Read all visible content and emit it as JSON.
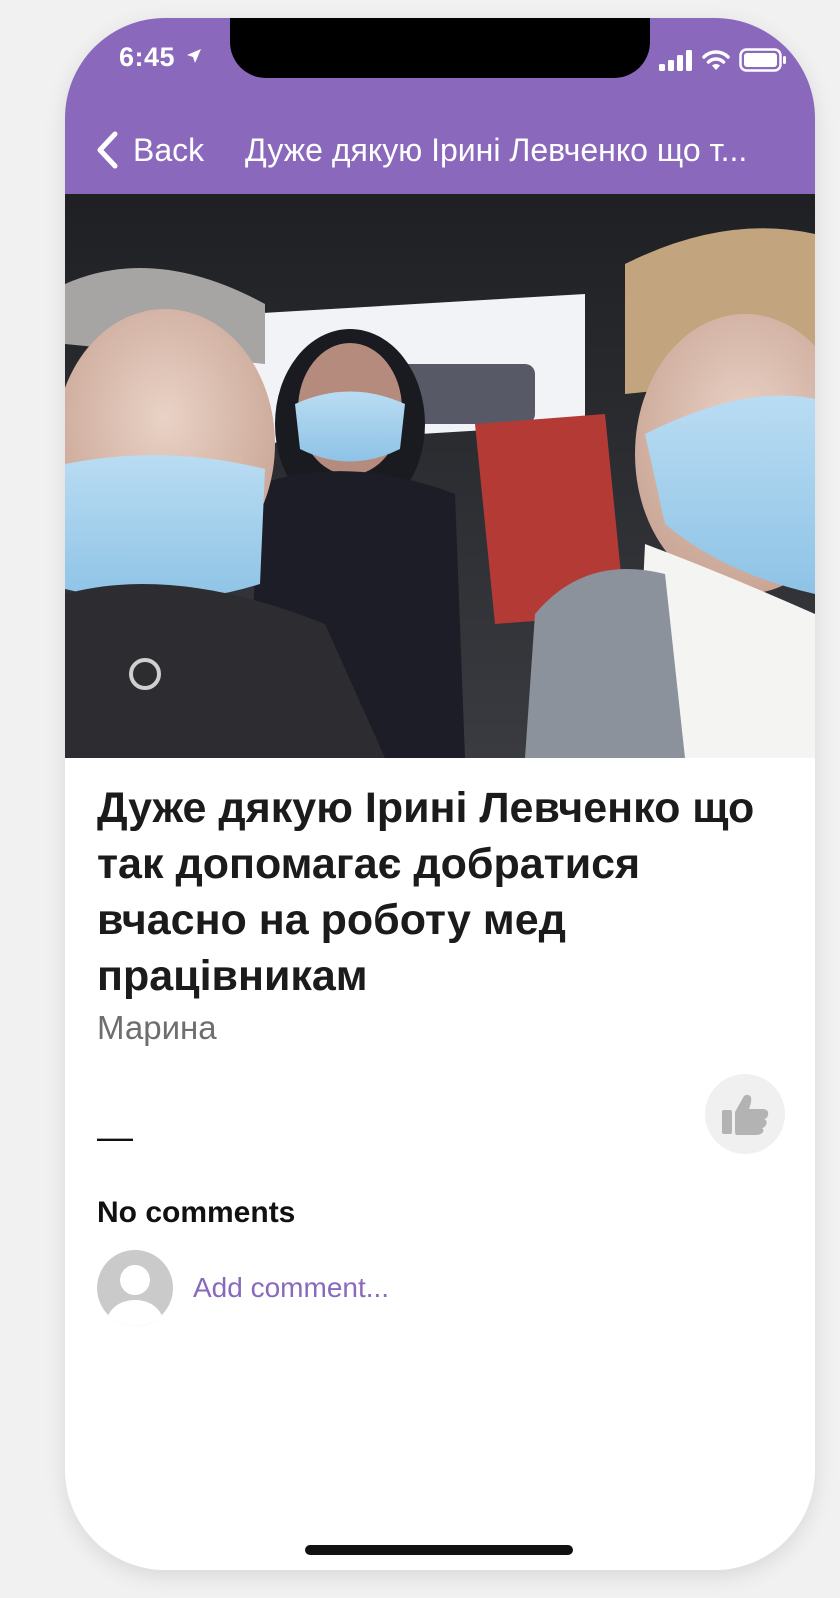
{
  "status_bar": {
    "time": "6:45",
    "icons": [
      "location-arrow-icon",
      "signal-icon",
      "wifi-icon",
      "battery-icon"
    ]
  },
  "nav": {
    "back_label": "Back",
    "title": "Дуже дякую Ірині Левченко що т..."
  },
  "post": {
    "title": "Дуже дякую Ірині Левченко що так допомагає добратися вчасно на роботу мед працівникам",
    "author": "Марина",
    "likes_placeholder": "—",
    "like_icon": "thumbs-up-icon"
  },
  "comments": {
    "label": "No comments",
    "add_placeholder": "Add comment..."
  },
  "colors": {
    "accent": "#8a69bd",
    "author_gray": "#6e6e6e"
  }
}
